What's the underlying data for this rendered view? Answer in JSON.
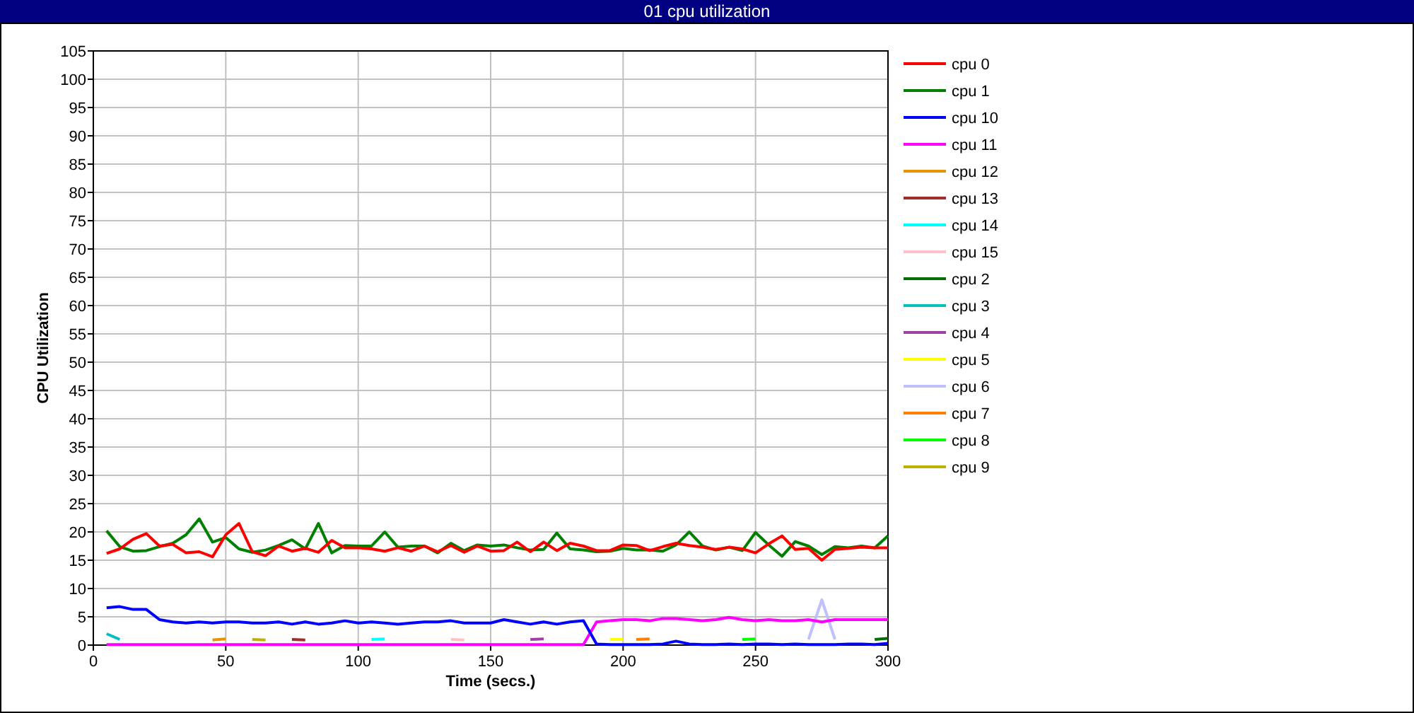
{
  "window": {
    "title": "01 cpu utilization"
  },
  "chart": {
    "chart_data": {
      "type": "line",
      "xlabel": "Time (secs.)",
      "ylabel": "CPU Utilization",
      "grid": true,
      "legend": true,
      "x": [
        5,
        10,
        15,
        20,
        25,
        30,
        35,
        40,
        45,
        50,
        55,
        60,
        65,
        70,
        75,
        80,
        85,
        90,
        95,
        100,
        105,
        110,
        115,
        120,
        125,
        130,
        135,
        140,
        145,
        150,
        155,
        160,
        165,
        170,
        175,
        180,
        185,
        190,
        195,
        200,
        205,
        210,
        215,
        220,
        225,
        230,
        235,
        240,
        245,
        250,
        255,
        260,
        265,
        270,
        275,
        280,
        285,
        290,
        295,
        300
      ],
      "xlim": [
        0,
        300
      ],
      "ylim": [
        0,
        105
      ],
      "xticks": [
        0,
        50,
        100,
        150,
        200,
        250,
        300
      ],
      "yticks": [
        0,
        5,
        10,
        15,
        20,
        25,
        30,
        35,
        40,
        45,
        50,
        55,
        60,
        65,
        70,
        75,
        80,
        85,
        90,
        95,
        100,
        105
      ],
      "series": [
        {
          "name": "cpu 0",
          "color": "#ff0000",
          "values": [
            16.2,
            17,
            18.7,
            19.7,
            17.5,
            17.8,
            16.3,
            16.5,
            15.6,
            19.5,
            21.5,
            16.5,
            15.8,
            17.5,
            16.6,
            17.1,
            16.4,
            18.5,
            17.2,
            17.2,
            17,
            16.6,
            17.2,
            16.6,
            17.5,
            16.5,
            17.6,
            16.4,
            17.5,
            16.6,
            16.7,
            18.2,
            16.5,
            18.2,
            16.7,
            18,
            17.5,
            16.7,
            16.7,
            17.7,
            17.6,
            16.7,
            17.4,
            18,
            17.6,
            17.3,
            16.9,
            17.3,
            17,
            16.3,
            17.9,
            19.3,
            16.9,
            17.1,
            15,
            16.9,
            17.1,
            17.3,
            17.2,
            17.2
          ]
        },
        {
          "name": "cpu 1",
          "color": "#008000",
          "values": [
            20.2,
            17.4,
            16.6,
            16.7,
            17.4,
            18,
            19.5,
            22.3,
            18.2,
            19,
            17,
            16.4,
            16.8,
            17.6,
            18.6,
            17,
            21.5,
            16.3,
            17.6,
            17.5,
            17.5,
            20,
            17.3,
            17.5,
            17.5,
            16.3,
            18,
            16.7,
            17.7,
            17.5,
            17.7,
            17.2,
            16.8,
            16.9,
            19.8,
            17,
            16.8,
            16.5,
            16.6,
            17.1,
            16.8,
            16.8,
            16.6,
            17.7,
            20,
            17.5,
            16.8,
            17.3,
            16.7,
            19.9,
            17.7,
            15.7,
            18.3,
            17.5,
            16,
            17.4,
            17.2,
            17.5,
            17.2,
            19.3
          ]
        },
        {
          "name": "cpu 10",
          "color": "#0000ff",
          "values": [
            6.6,
            6.8,
            6.3,
            6.3,
            4.5,
            4.1,
            3.9,
            4.1,
            3.9,
            4.1,
            4.1,
            3.9,
            3.9,
            4.1,
            3.7,
            4.1,
            3.7,
            3.9,
            4.3,
            3.9,
            4.1,
            3.9,
            3.7,
            3.9,
            4.1,
            4.1,
            4.3,
            3.9,
            3.9,
            3.9,
            4.5,
            4.1,
            3.7,
            4.1,
            3.7,
            4.1,
            4.3,
            0.2,
            0.1,
            0.1,
            0.1,
            0.1,
            0.2,
            0.7,
            0.2,
            0.1,
            0.1,
            0.2,
            0.1,
            0.2,
            0.2,
            0.1,
            0.2,
            0.1,
            0.1,
            0.1,
            0.2,
            0.2,
            0.1,
            0.3
          ]
        },
        {
          "name": "cpu 11",
          "color": "#ff00ff",
          "values": [
            0.1,
            0.1,
            0.1,
            0.1,
            0.1,
            0.1,
            0.1,
            0.1,
            0.1,
            0.1,
            0.1,
            0.1,
            0.1,
            0.1,
            0.1,
            0.1,
            0.1,
            0.1,
            0.1,
            0.1,
            0.1,
            0.1,
            0.1,
            0.1,
            0.1,
            0.1,
            0.1,
            0.1,
            0.1,
            0.1,
            0.1,
            0.1,
            0.1,
            0.1,
            0.1,
            0.1,
            0.1,
            4.1,
            4.3,
            4.5,
            4.5,
            4.3,
            4.7,
            4.7,
            4.5,
            4.3,
            4.5,
            4.9,
            4.5,
            4.3,
            4.5,
            4.3,
            4.3,
            4.5,
            4.1,
            4.5,
            4.5,
            4.5,
            4.5,
            4.5
          ]
        },
        {
          "name": "cpu 12",
          "color": "#e69500",
          "values": [
            null,
            null,
            null,
            null,
            null,
            null,
            null,
            null,
            0.9,
            1.1,
            null,
            null,
            null,
            null,
            null,
            null,
            null,
            null,
            null,
            null,
            null,
            null,
            null,
            null,
            null,
            null,
            null,
            null,
            null,
            null,
            null,
            null,
            null,
            null,
            null,
            null,
            null,
            null,
            null,
            null,
            null,
            null,
            null,
            null,
            null,
            null,
            null,
            null,
            null,
            null,
            null,
            null,
            null,
            null,
            null,
            null,
            null,
            null,
            null,
            null
          ]
        },
        {
          "name": "cpu 13",
          "color": "#a52a2a",
          "values": [
            null,
            null,
            null,
            null,
            null,
            null,
            null,
            null,
            null,
            null,
            null,
            null,
            null,
            null,
            1,
            0.9,
            null,
            null,
            null,
            null,
            null,
            null,
            null,
            null,
            null,
            null,
            null,
            null,
            null,
            null,
            null,
            null,
            null,
            null,
            null,
            null,
            null,
            null,
            null,
            null,
            null,
            null,
            null,
            null,
            null,
            null,
            null,
            null,
            null,
            null,
            null,
            null,
            null,
            null,
            null,
            null,
            null,
            null,
            null,
            null
          ]
        },
        {
          "name": "cpu 14",
          "color": "#00ffff",
          "values": [
            null,
            null,
            null,
            null,
            null,
            null,
            null,
            null,
            null,
            null,
            null,
            null,
            null,
            null,
            null,
            null,
            null,
            null,
            null,
            null,
            1,
            1.1,
            null,
            null,
            null,
            null,
            null,
            null,
            null,
            null,
            null,
            null,
            null,
            null,
            null,
            null,
            null,
            null,
            null,
            null,
            null,
            null,
            null,
            null,
            null,
            null,
            null,
            null,
            null,
            null,
            null,
            null,
            null,
            null,
            null,
            null,
            null,
            null,
            null,
            null
          ]
        },
        {
          "name": "cpu 15",
          "color": "#ffc0cb",
          "values": [
            null,
            null,
            null,
            null,
            null,
            null,
            null,
            null,
            null,
            null,
            null,
            null,
            null,
            null,
            null,
            null,
            null,
            null,
            null,
            null,
            null,
            null,
            null,
            null,
            null,
            null,
            1,
            0.9,
            null,
            null,
            null,
            null,
            null,
            null,
            null,
            null,
            null,
            null,
            null,
            null,
            null,
            null,
            null,
            null,
            null,
            null,
            null,
            null,
            null,
            null,
            null,
            null,
            null,
            null,
            null,
            null,
            null,
            null,
            null,
            null
          ]
        },
        {
          "name": "cpu 2",
          "color": "#007000",
          "values": [
            null,
            null,
            null,
            null,
            null,
            null,
            null,
            null,
            null,
            null,
            null,
            null,
            null,
            null,
            null,
            null,
            null,
            null,
            null,
            null,
            null,
            null,
            null,
            null,
            null,
            null,
            null,
            null,
            null,
            null,
            null,
            null,
            null,
            null,
            null,
            null,
            null,
            null,
            null,
            null,
            null,
            null,
            null,
            null,
            null,
            null,
            null,
            null,
            null,
            null,
            null,
            null,
            null,
            null,
            null,
            null,
            null,
            null,
            1,
            1.2
          ]
        },
        {
          "name": "cpu 3",
          "color": "#00c0c0",
          "values": [
            2,
            1,
            null,
            null,
            null,
            null,
            null,
            null,
            null,
            null,
            null,
            null,
            null,
            null,
            null,
            null,
            null,
            null,
            null,
            null,
            null,
            null,
            null,
            null,
            null,
            null,
            null,
            null,
            null,
            null,
            null,
            null,
            null,
            null,
            null,
            null,
            null,
            null,
            null,
            null,
            null,
            null,
            null,
            null,
            null,
            null,
            null,
            null,
            null,
            null,
            null,
            null,
            null,
            null,
            null,
            null,
            null,
            null,
            null,
            null
          ]
        },
        {
          "name": "cpu 4",
          "color": "#a040a0",
          "values": [
            null,
            null,
            null,
            null,
            null,
            null,
            null,
            null,
            null,
            null,
            null,
            null,
            null,
            null,
            null,
            null,
            null,
            null,
            null,
            null,
            null,
            null,
            null,
            null,
            null,
            null,
            null,
            null,
            null,
            null,
            null,
            null,
            1,
            1.1,
            null,
            null,
            null,
            null,
            null,
            null,
            null,
            null,
            null,
            null,
            null,
            null,
            null,
            null,
            null,
            null,
            null,
            null,
            null,
            null,
            null,
            null,
            null,
            null,
            null,
            null
          ]
        },
        {
          "name": "cpu 5",
          "color": "#ffff00",
          "values": [
            null,
            null,
            null,
            null,
            null,
            null,
            null,
            null,
            null,
            null,
            null,
            null,
            null,
            null,
            null,
            null,
            null,
            null,
            null,
            null,
            null,
            null,
            null,
            null,
            null,
            null,
            null,
            null,
            null,
            null,
            null,
            null,
            null,
            null,
            null,
            null,
            null,
            null,
            1,
            1,
            null,
            null,
            null,
            null,
            null,
            null,
            null,
            null,
            null,
            null,
            null,
            null,
            null,
            null,
            null,
            null,
            null,
            null,
            null,
            null
          ]
        },
        {
          "name": "cpu 6",
          "color": "#c0c0ff",
          "values": [
            null,
            null,
            null,
            null,
            null,
            null,
            null,
            null,
            null,
            null,
            null,
            null,
            null,
            null,
            null,
            null,
            null,
            null,
            null,
            null,
            null,
            null,
            null,
            null,
            null,
            null,
            null,
            null,
            null,
            null,
            null,
            null,
            null,
            null,
            null,
            null,
            null,
            null,
            null,
            null,
            null,
            null,
            null,
            null,
            null,
            null,
            null,
            null,
            null,
            null,
            null,
            null,
            null,
            1,
            8,
            1,
            null,
            null,
            null,
            null
          ]
        },
        {
          "name": "cpu 7",
          "color": "#ff8000",
          "values": [
            null,
            null,
            null,
            null,
            null,
            null,
            null,
            null,
            null,
            null,
            null,
            null,
            null,
            null,
            null,
            null,
            null,
            null,
            null,
            null,
            null,
            null,
            null,
            null,
            null,
            null,
            null,
            null,
            null,
            null,
            null,
            null,
            null,
            null,
            null,
            null,
            null,
            null,
            null,
            null,
            1,
            1.1,
            null,
            null,
            null,
            null,
            null,
            null,
            null,
            null,
            null,
            null,
            null,
            null,
            null,
            null,
            null,
            null,
            null,
            null
          ]
        },
        {
          "name": "cpu 8",
          "color": "#00ff00",
          "values": [
            null,
            null,
            null,
            null,
            null,
            null,
            null,
            null,
            null,
            null,
            null,
            null,
            null,
            null,
            null,
            null,
            null,
            null,
            null,
            null,
            null,
            null,
            null,
            null,
            null,
            null,
            null,
            null,
            null,
            null,
            null,
            null,
            null,
            null,
            null,
            null,
            null,
            null,
            null,
            null,
            null,
            null,
            null,
            null,
            null,
            null,
            null,
            null,
            1,
            1.1,
            null,
            null,
            null,
            null,
            null,
            null,
            null,
            null,
            null,
            null
          ]
        },
        {
          "name": "cpu 9",
          "color": "#c0b000",
          "values": [
            null,
            null,
            null,
            null,
            null,
            null,
            null,
            null,
            null,
            null,
            null,
            1,
            0.9,
            null,
            null,
            null,
            null,
            null,
            null,
            null,
            null,
            null,
            null,
            null,
            null,
            null,
            null,
            null,
            null,
            null,
            null,
            null,
            null,
            null,
            null,
            null,
            null,
            null,
            null,
            null,
            null,
            null,
            null,
            null,
            null,
            null,
            null,
            null,
            null,
            null,
            null,
            null,
            null,
            null,
            null,
            null,
            null,
            null,
            null,
            null
          ]
        }
      ]
    }
  }
}
